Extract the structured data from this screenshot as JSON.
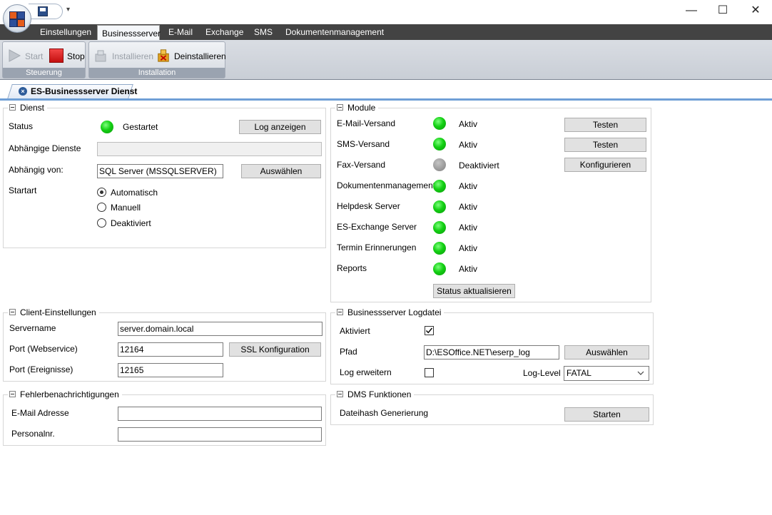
{
  "window": {
    "minimize": "—",
    "maximize": "☐",
    "close": "✕"
  },
  "ribbon": {
    "tabs": [
      {
        "label": "Einstellungen"
      },
      {
        "label": "Businessserver"
      },
      {
        "label": "E-Mail"
      },
      {
        "label": "Exchange"
      },
      {
        "label": "SMS"
      },
      {
        "label": "Dokumentenmanagement"
      }
    ],
    "active_tab": "Businessserver",
    "groups": {
      "steuerung": {
        "label": "Steuerung",
        "start": "Start",
        "stop": "Stop"
      },
      "installation": {
        "label": "Installation",
        "install": "Installieren",
        "uninstall": "Deinstallieren"
      }
    }
  },
  "doc_tab": {
    "title": "ES-Businessserver Dienst",
    "close_glyph": "×"
  },
  "dienst": {
    "title": "Dienst",
    "status_label": "Status",
    "status_value": "Gestartet",
    "log_button": "Log anzeigen",
    "dependent_label": "Abhängige Dienste",
    "dependent_value": "",
    "depends_on_label": "Abhängig von:",
    "depends_on_value": "SQL Server (MSSQLSERVER)",
    "select_button": "Auswählen",
    "startart_label": "Startart",
    "startart_options": [
      "Automatisch",
      "Manuell",
      "Deaktiviert"
    ],
    "startart_selected": "Automatisch"
  },
  "module": {
    "title": "Module",
    "items": [
      {
        "name": "E-Mail-Versand",
        "status": "Aktiv",
        "on": true,
        "button": "Testen"
      },
      {
        "name": "SMS-Versand",
        "status": "Aktiv",
        "on": true,
        "button": "Testen"
      },
      {
        "name": "Fax-Versand",
        "status": "Deaktiviert",
        "on": false,
        "button": "Konfigurieren"
      },
      {
        "name": "Dokumentenmanagement",
        "status": "Aktiv",
        "on": true
      },
      {
        "name": "Helpdesk Server",
        "status": "Aktiv",
        "on": true
      },
      {
        "name": "ES-Exchange Server",
        "status": "Aktiv",
        "on": true
      },
      {
        "name": "Termin Erinnerungen",
        "status": "Aktiv",
        "on": true
      },
      {
        "name": "Reports",
        "status": "Aktiv",
        "on": true
      }
    ],
    "refresh_button": "Status aktualisieren",
    "colors": {
      "active": "#13d013",
      "inactive": "#9a9a9a"
    }
  },
  "client": {
    "title": "Client-Einstellungen",
    "servername_label": "Servername",
    "servername_value": "server.domain.local",
    "port_web_label": "Port (Webservice)",
    "port_web_value": "12164",
    "ssl_button": "SSL Konfiguration",
    "port_events_label": "Port (Ereignisse)",
    "port_events_value": "12165"
  },
  "fehler": {
    "title": "Fehlerbenachrichtigungen",
    "email_label": "E-Mail Adresse",
    "email_value": "",
    "personal_label": "Personalnr.",
    "personal_value": ""
  },
  "logdatei": {
    "title": "Businessserver Logdatei",
    "activated_label": "Aktiviert",
    "activated_checked": true,
    "path_label": "Pfad",
    "path_value": "D:\\ESOffice.NET\\eserp_log",
    "select_button": "Auswählen",
    "extended_label": "Log erweitern",
    "extended_checked": false,
    "level_label": "Log-Level",
    "level_value": "FATAL"
  },
  "dms": {
    "title": "DMS Funktionen",
    "hash_label": "Dateihash Generierung",
    "start_button": "Starten"
  }
}
